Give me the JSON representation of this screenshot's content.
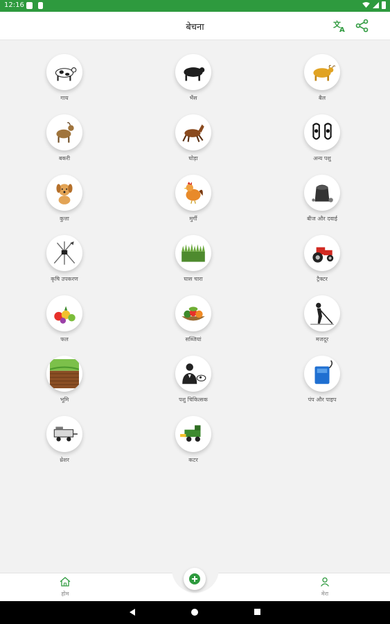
{
  "status_bar": {
    "time": "12:16"
  },
  "app_bar": {
    "title": "बेचना",
    "translate_icon": "translate-icon",
    "share_icon": "share-icon"
  },
  "categories": [
    {
      "label": "गाय",
      "icon": "cow"
    },
    {
      "label": "भैंस",
      "icon": "buffalo"
    },
    {
      "label": "बैल",
      "icon": "bull"
    },
    {
      "label": "बकरी",
      "icon": "goat"
    },
    {
      "label": "घोड़ा",
      "icon": "horse"
    },
    {
      "label": "अन्य पशु",
      "icon": "other-animals"
    },
    {
      "label": "कुत्ता",
      "icon": "dog"
    },
    {
      "label": "मुर्गी",
      "icon": "hen"
    },
    {
      "label": "बीज और दवाई",
      "icon": "seeds"
    },
    {
      "label": "कृषि उपकरण",
      "icon": "farm-tools"
    },
    {
      "label": "घास चारा",
      "icon": "fodder"
    },
    {
      "label": "ट्रैक्टर",
      "icon": "tractor"
    },
    {
      "label": "फल",
      "icon": "fruits"
    },
    {
      "label": "सब्जियां",
      "icon": "vegetables"
    },
    {
      "label": "मजदूर",
      "icon": "labour"
    },
    {
      "label": "भूमि",
      "icon": "land"
    },
    {
      "label": "पशु चिकित्सक",
      "icon": "veterinarian"
    },
    {
      "label": "पंप और पाइप",
      "icon": "pump"
    },
    {
      "label": "थ्रेशर",
      "icon": "thresher"
    },
    {
      "label": "कटर",
      "icon": "cutter"
    }
  ],
  "bottom_nav": {
    "home_label": "होम",
    "profile_label": "मेरा"
  },
  "colors": {
    "brand": "#2e9a3e"
  }
}
